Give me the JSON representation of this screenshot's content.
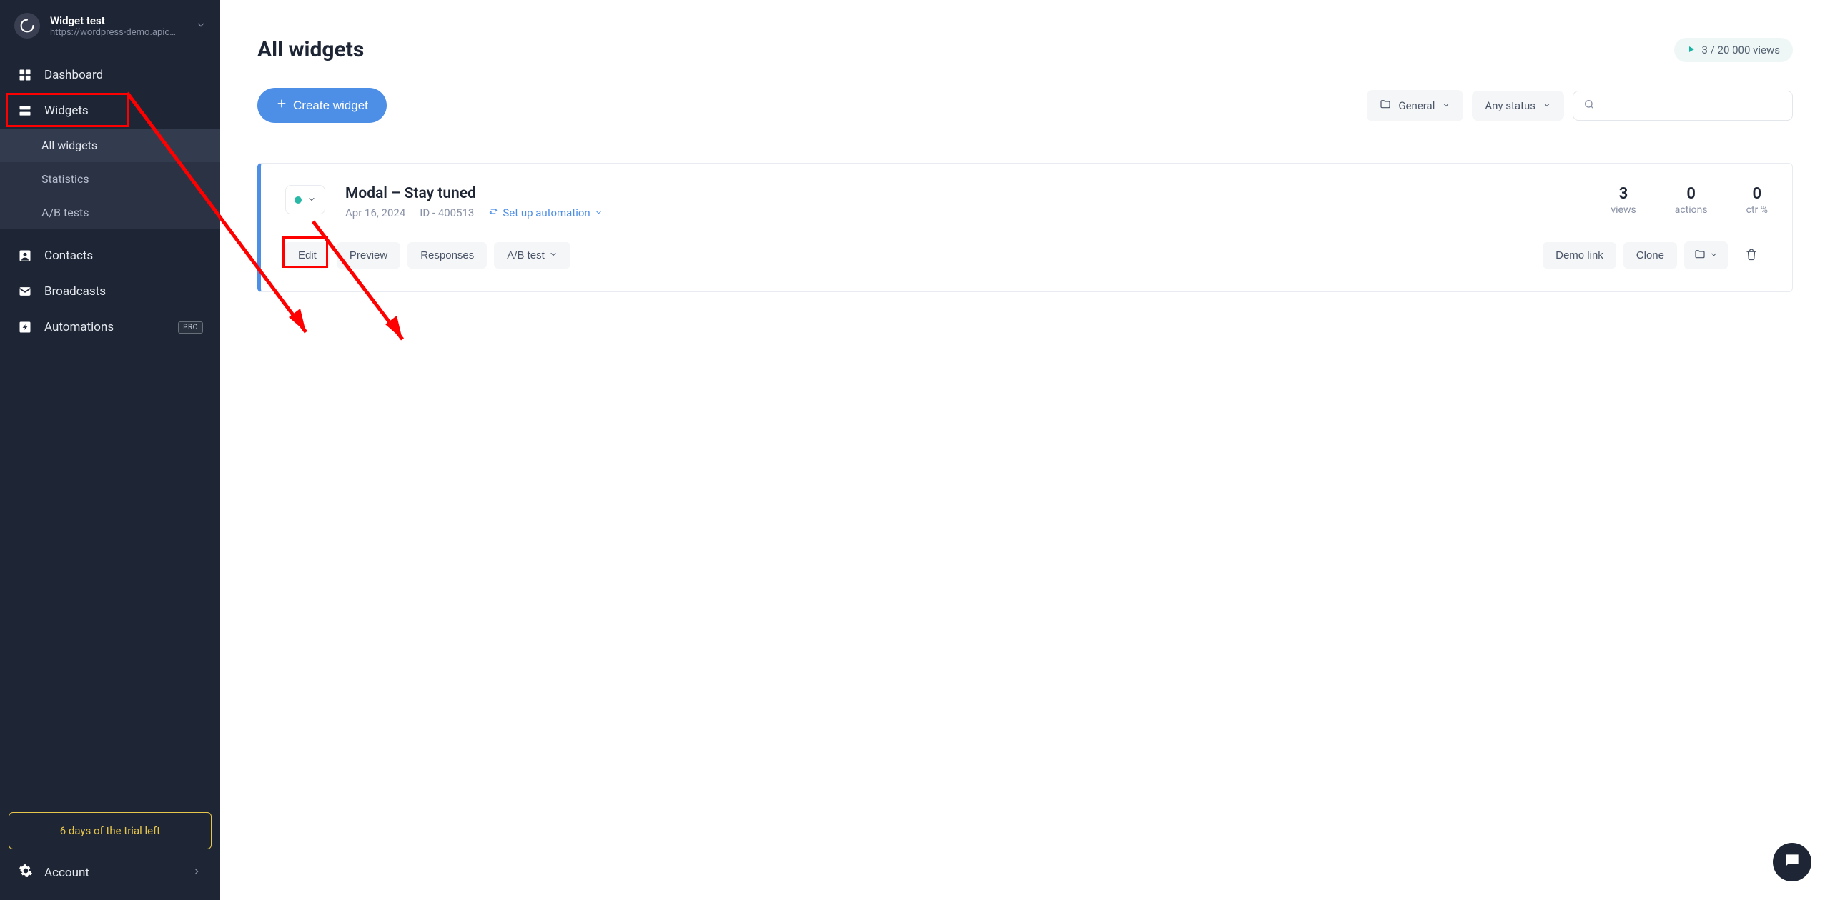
{
  "sidebar": {
    "project": {
      "title": "Widget test",
      "url": "https://wordpress-demo.apic…"
    },
    "items": {
      "dashboard": "Dashboard",
      "widgets": "Widgets",
      "widgets_sub": {
        "all": "All widgets",
        "stats": "Statistics",
        "ab": "A/B tests"
      },
      "contacts": "Contacts",
      "broadcasts": "Broadcasts",
      "automations": "Automations",
      "automations_badge": "PRO"
    },
    "trial": "6 days of the trial left",
    "account": "Account"
  },
  "page": {
    "title": "All widgets",
    "views_badge": "3 / 20 000 views",
    "create_btn": "Create widget",
    "filter_folder": "General",
    "filter_status": "Any status"
  },
  "card": {
    "title": "Modal – Stay tuned",
    "date": "Apr 16, 2024",
    "id": "ID - 400513",
    "automation": "Set up automation",
    "stats": {
      "views": {
        "value": "3",
        "label": "views"
      },
      "actions": {
        "value": "0",
        "label": "actions"
      },
      "ctr": {
        "value": "0",
        "label": "ctr %"
      }
    },
    "actions": {
      "edit": "Edit",
      "preview": "Preview",
      "responses": "Responses",
      "ab": "A/B test",
      "demo": "Demo link",
      "clone": "Clone"
    }
  }
}
